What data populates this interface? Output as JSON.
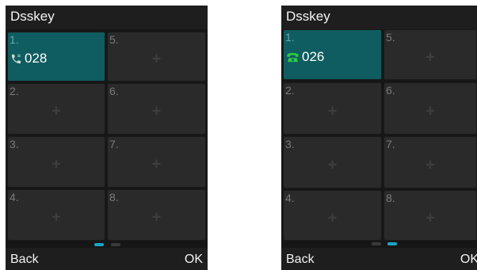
{
  "left": {
    "title": "Dsskey",
    "keys": [
      {
        "num": "1.",
        "label": "028"
      },
      {
        "num": "2."
      },
      {
        "num": "3."
      },
      {
        "num": "4."
      },
      {
        "num": "5."
      },
      {
        "num": "6."
      },
      {
        "num": "7."
      },
      {
        "num": "8."
      }
    ],
    "plus": "+",
    "back": "Back",
    "ok": "OK"
  },
  "right": {
    "title": "Dsskey",
    "keys": [
      {
        "num": "1.",
        "label": "026"
      },
      {
        "num": "2."
      },
      {
        "num": "3."
      },
      {
        "num": "4."
      },
      {
        "num": "5."
      },
      {
        "num": "6."
      },
      {
        "num": "7."
      },
      {
        "num": "8."
      }
    ],
    "plus": "+",
    "back": "Back",
    "ok": "OK"
  },
  "colors": {
    "active_key": "#0f5d60",
    "pager_active": "#1aa7c4",
    "pager_inactive": "#3a3a3a",
    "phone_icon_idle": "#cfd8d8",
    "phone_icon_green": "#2ecc40"
  },
  "icons": {
    "left_key_icon": "phone-handset-icon",
    "right_key_icon": "desk-phone-icon"
  }
}
